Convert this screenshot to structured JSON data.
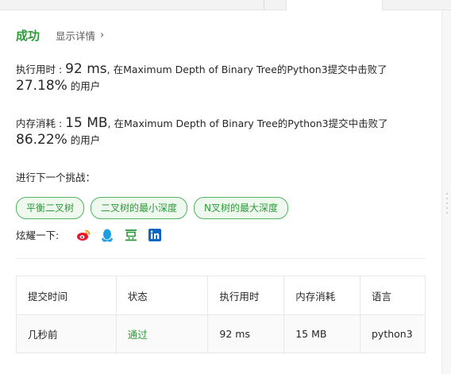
{
  "result": {
    "status": "成功",
    "details_link": "显示详情",
    "chevron": "›"
  },
  "runtime": {
    "label": "执行用时 : ",
    "value": "92 ms",
    "middle": ", 在Maximum Depth of Binary Tree的Python3提交中击败了",
    "percent": "27.18%",
    "suffix": " 的用户"
  },
  "memory": {
    "label": "内存消耗 : ",
    "value": "15 MB",
    "middle": ", 在Maximum Depth of Binary Tree的Python3提交中击败了",
    "percent": "86.22%",
    "suffix": " 的用户"
  },
  "next_challenge": {
    "label": "进行下一个挑战：",
    "tags": [
      "平衡二叉树",
      "二叉树的最小深度",
      "N叉树的最大深度"
    ]
  },
  "share": {
    "label": "炫耀一下:",
    "icons": [
      "weibo-icon",
      "qq-icon",
      "douban-icon",
      "linkedin-icon"
    ]
  },
  "submissions": {
    "headers": [
      "提交时间",
      "状态",
      "执行用时",
      "内存消耗",
      "语言"
    ],
    "rows": [
      [
        "几秒前",
        "通过",
        "92 ms",
        "15 MB",
        "python3"
      ]
    ]
  },
  "colors": {
    "success": "#2e9a3a",
    "weibo": "#e6162d",
    "qq": "#1d9ee0",
    "douban": "#2e963d",
    "linkedin": "#0a66c2"
  }
}
